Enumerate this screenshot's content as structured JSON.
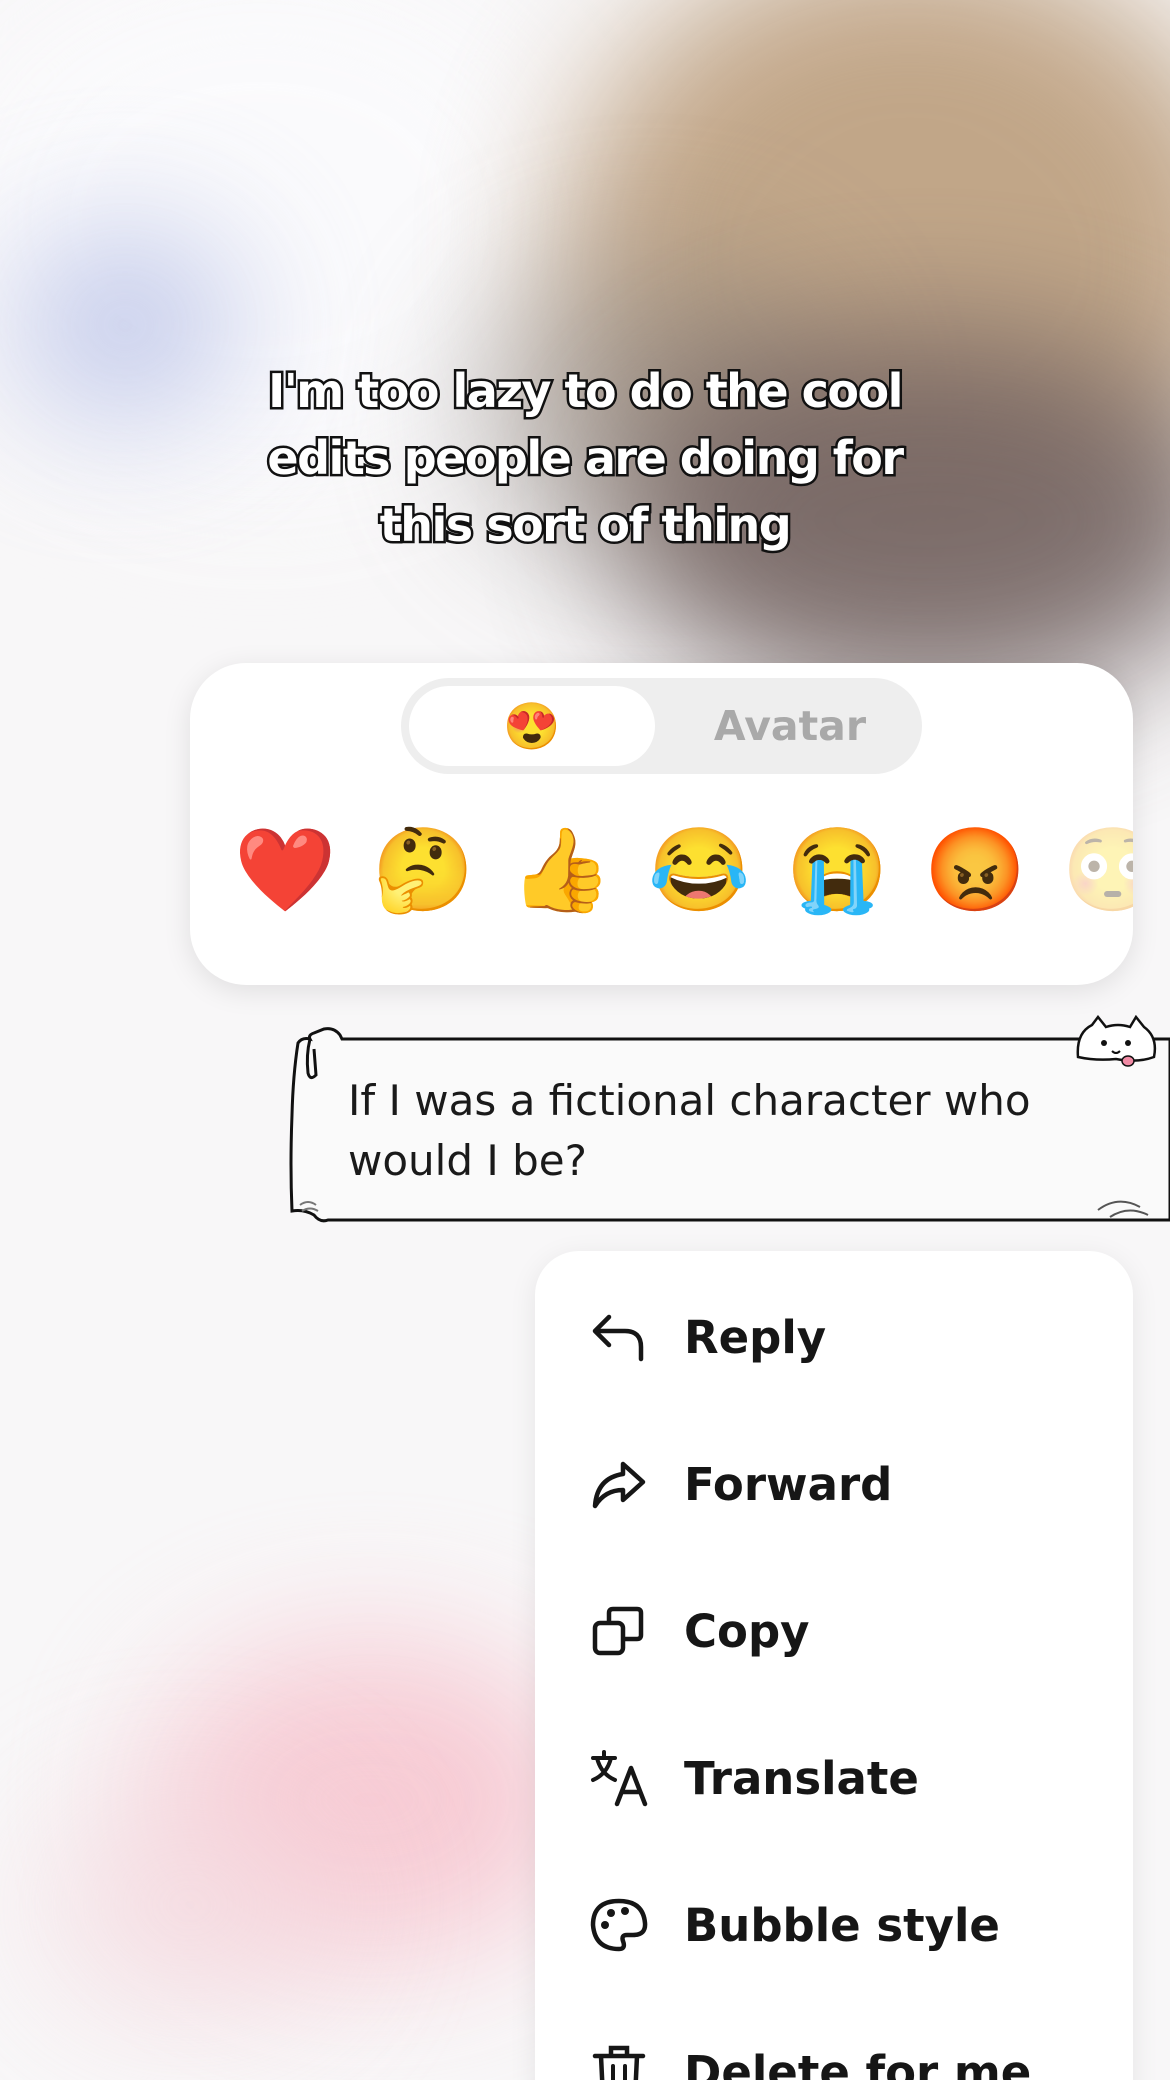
{
  "caption": {
    "lines": [
      "I'm too lazy to do the cool",
      "edits people are doing for",
      "this sort of thing"
    ]
  },
  "reaction_panel": {
    "tabs": [
      {
        "label": "😍",
        "selected": true
      },
      {
        "label": "Avatar",
        "selected": false
      }
    ],
    "reactions": [
      "❤️",
      "🤔",
      "👍",
      "😂",
      "😭",
      "😡",
      "😳"
    ]
  },
  "message": {
    "text": "If I was a fictional character who would I be?"
  },
  "context_menu": {
    "items": [
      {
        "label": "Reply",
        "icon": "reply-icon"
      },
      {
        "label": "Forward",
        "icon": "forward-icon"
      },
      {
        "label": "Copy",
        "icon": "copy-icon"
      },
      {
        "label": "Translate",
        "icon": "translate-icon"
      },
      {
        "label": "Bubble style",
        "icon": "palette-icon"
      },
      {
        "label": "Delete for me",
        "icon": "trash-icon"
      }
    ]
  },
  "colors": {
    "menu_text": "#161616",
    "inactive_tab": "#a9a9a9",
    "heart": "#e5252f"
  }
}
